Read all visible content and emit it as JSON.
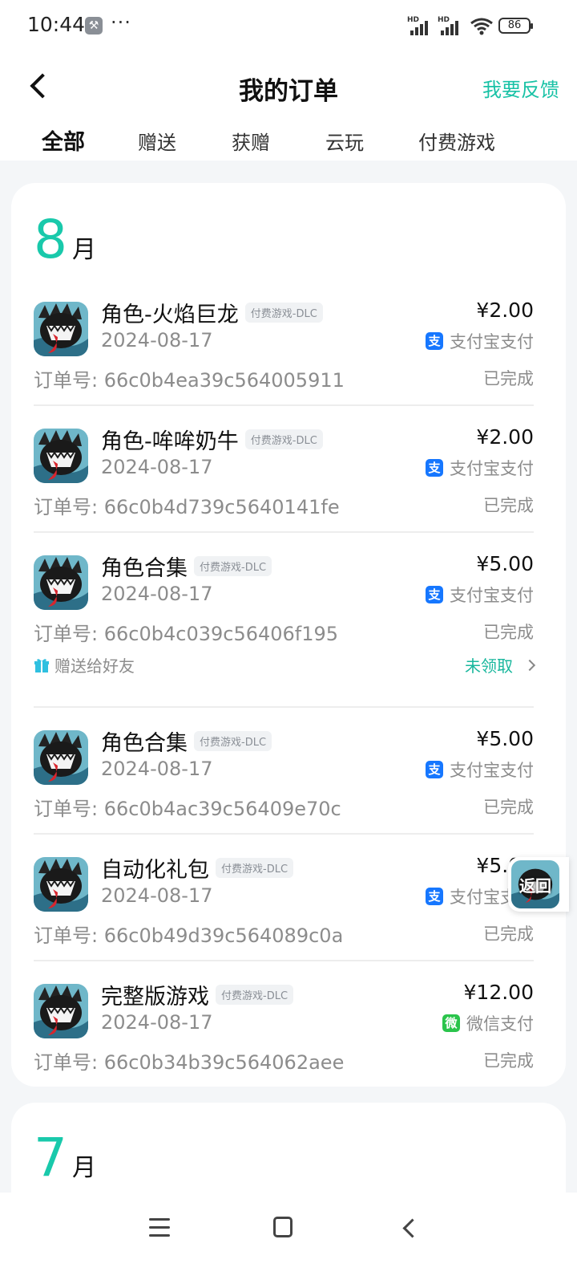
{
  "status_bar": {
    "time": "10:44",
    "more": "···",
    "battery": "86",
    "sig_label": "HD"
  },
  "header": {
    "title": "我的订单",
    "feedback": "我要反馈"
  },
  "tabs": [
    {
      "label": "全部",
      "active": true
    },
    {
      "label": "赠送"
    },
    {
      "label": "获赠"
    },
    {
      "label": "云玩"
    },
    {
      "label": "付费游戏"
    }
  ],
  "months": [
    {
      "num": "8",
      "unit": "月",
      "orders": [
        {
          "name": "角色-火焰巨龙",
          "tag": "付费游戏-DLC",
          "date": "2024-08-17",
          "price": "¥2.00",
          "pay": "支付宝支付",
          "pay_icon": "支",
          "order_label": "订单号:",
          "order_no": "66c0b4ea39c564005911",
          "status": "已完成"
        },
        {
          "name": "角色-哞哞奶牛",
          "tag": "付费游戏-DLC",
          "date": "2024-08-17",
          "price": "¥2.00",
          "pay": "支付宝支付",
          "pay_icon": "支",
          "order_label": "订单号:",
          "order_no": "66c0b4d739c5640141fe",
          "status": "已完成"
        },
        {
          "name": "角色合集",
          "tag": "付费游戏-DLC",
          "date": "2024-08-17",
          "price": "¥5.00",
          "pay": "支付宝支付",
          "pay_icon": "支",
          "order_label": "订单号:",
          "order_no": "66c0b4c039c56406f195",
          "status": "已完成",
          "gift": {
            "label": "赠送给好友",
            "status": "未领取"
          }
        },
        {
          "name": "角色合集",
          "tag": "付费游戏-DLC",
          "date": "2024-08-17",
          "price": "¥5.00",
          "pay": "支付宝支付",
          "pay_icon": "支",
          "order_label": "订单号:",
          "order_no": "66c0b4ac39c56409e70c",
          "status": "已完成"
        },
        {
          "name": "自动化礼包",
          "tag": "付费游戏-DLC",
          "date": "2024-08-17",
          "price": "¥5.00",
          "pay": "支付宝支付",
          "pay_icon": "支",
          "order_label": "订单号:",
          "order_no": "66c0b49d39c564089c0a",
          "status": "已完成"
        },
        {
          "name": "完整版游戏",
          "tag": "付费游戏-DLC",
          "date": "2024-08-17",
          "price": "¥12.00",
          "pay": "微信支付",
          "pay_icon": "微",
          "order_label": "订单号:",
          "order_no": "66c0b34b39c564062aee",
          "status": "已完成"
        }
      ]
    },
    {
      "num": "7",
      "unit": "月",
      "orders": []
    }
  ],
  "float_return": {
    "label": "返回"
  },
  "colors": {
    "accent": "#19c9ab",
    "alipay": "#1677ff",
    "wechat": "#2ac44b"
  },
  "icons": {
    "back": "chevron-left-icon",
    "gift": "gift-icon",
    "nav_menu": "menu-icon",
    "nav_home": "home-icon",
    "nav_back": "back-triangle-icon"
  }
}
